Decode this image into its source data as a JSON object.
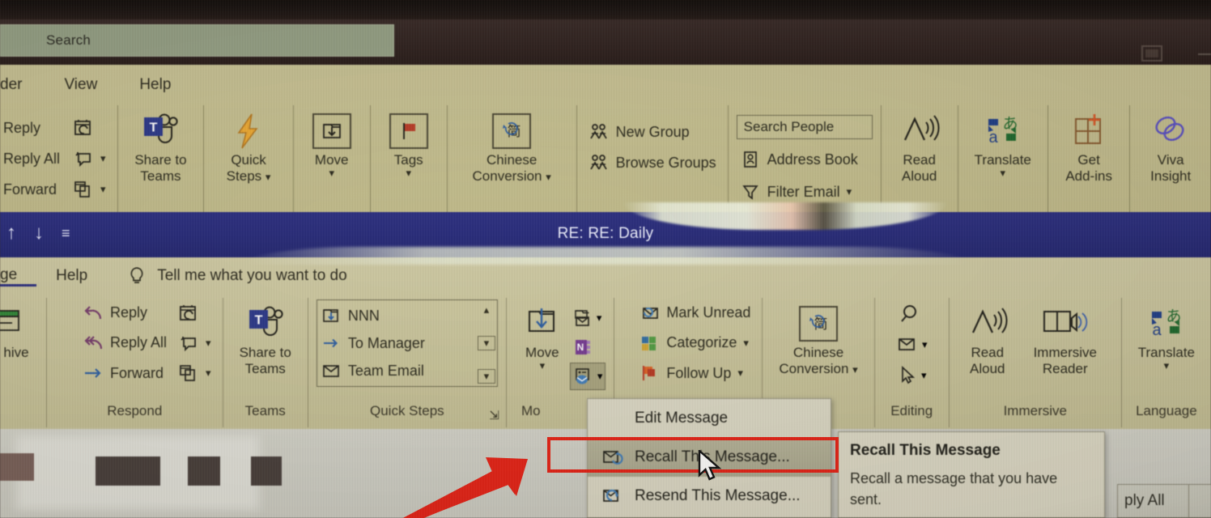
{
  "window": {
    "search_placeholder": "Search",
    "ribbon_display_options_icon": "ribbon-display-options-icon"
  },
  "main_ribbon": {
    "tabs": [
      {
        "label": "der"
      },
      {
        "label": "View"
      },
      {
        "label": "Help"
      }
    ],
    "respond": {
      "reply": "Reply",
      "reply_all": "Reply All",
      "forward": "Forward"
    },
    "teams": {
      "line1": "Share to",
      "line2": "Teams"
    },
    "quick_steps": {
      "line1": "Quick",
      "line2": "Steps"
    },
    "move": {
      "label": "Move"
    },
    "tags": {
      "label": "Tags"
    },
    "chinese_conversion": {
      "line1": "Chinese",
      "line2": "Conversion"
    },
    "find": {
      "new_group": "New Group",
      "browse_groups": "Browse Groups",
      "search_people_placeholder": "Search People",
      "address_book": "Address Book",
      "filter_email": "Filter Email"
    },
    "speech": {
      "line1": "Read",
      "line2": "Aloud"
    },
    "language": {
      "line1": "Translate"
    },
    "addins": {
      "line1": "Get",
      "line2": "Add-ins"
    },
    "viva": {
      "line1": "Viva",
      "line2": "Insight"
    }
  },
  "message_window": {
    "subject": "RE: RE: Daily",
    "quick_access": [
      "up-arrow-icon",
      "down-arrow-icon",
      "customize-qat-icon"
    ],
    "tabs": [
      {
        "label": "ge"
      },
      {
        "label": "Help"
      }
    ],
    "tell_me": "Tell me what you want to do",
    "archive_label": "hive",
    "respond": {
      "group_label": "Respond",
      "reply": "Reply",
      "reply_all": "Reply All",
      "forward": "Forward"
    },
    "teams": {
      "group_label": "Teams",
      "line1": "Share to",
      "line2": "Teams"
    },
    "quick_steps": {
      "group_label": "Quick Steps",
      "items": [
        "NNN",
        "To Manager",
        "Team Email"
      ]
    },
    "move": {
      "group_label": "Mo",
      "label": "Move"
    },
    "tags": {
      "mark_unread": "Mark Unread",
      "categorize": "Categorize",
      "follow_up": "Follow Up"
    },
    "chinese_conversion": {
      "line1": "Chinese",
      "line2": "Conversion"
    },
    "editing": {
      "group_label": "Editing"
    },
    "immersive": {
      "group_label": "Immersive",
      "read_aloud_l1": "Read",
      "read_aloud_l2": "Aloud",
      "immersive_reader_l1": "Immersive",
      "immersive_reader_l2": "Reader"
    },
    "language": {
      "group_label": "Language",
      "translate": "Translate"
    }
  },
  "dropdown_menu": {
    "items": [
      {
        "label": "Edit Message",
        "accel": "E",
        "icon": "none",
        "highlighted": false
      },
      {
        "label": "Recall This Message...",
        "accel": "T",
        "icon": "recall-message-icon",
        "highlighted": true
      },
      {
        "label": "Resend This Message...",
        "accel": "s",
        "icon": "resend-message-icon",
        "highlighted": false
      }
    ]
  },
  "tooltip": {
    "title": "Recall This Message",
    "body": "Recall a message that you have sent."
  },
  "annotations": {
    "highlight_color": "#f42012",
    "arrow": "red-arrow-annotation"
  },
  "background_window": {
    "reply_all_partial": "ply All"
  }
}
